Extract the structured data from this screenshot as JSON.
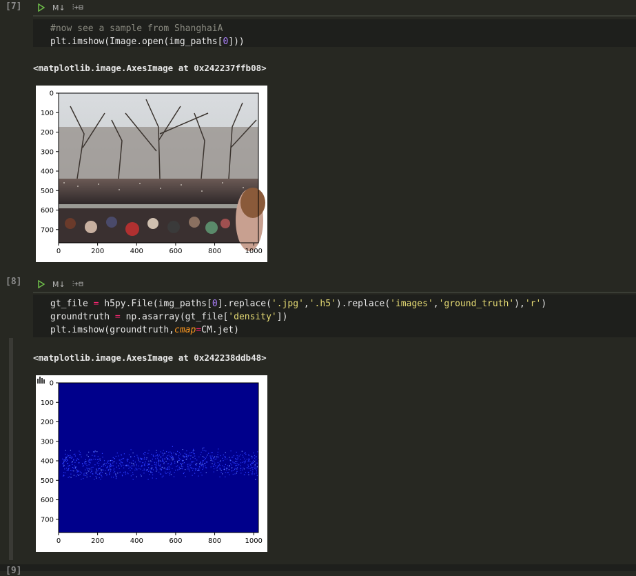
{
  "cells": [
    {
      "exec_count": "[7]",
      "toolbar": {
        "md_label": "M↓",
        "split_label": "⫶+⊟"
      },
      "code_lines": [
        "#now see a sample from ShanghaiA",
        "plt.imshow(Image.open(img_paths[0]))"
      ],
      "output_text": "<matplotlib.image.AxesImage at 0x242237ffb08>",
      "plot": {
        "kind": "photo",
        "x_ticks": [
          "0",
          "200",
          "400",
          "600",
          "800",
          "1000"
        ],
        "y_ticks": [
          "0",
          "100",
          "200",
          "300",
          "400",
          "500",
          "600",
          "700"
        ]
      }
    },
    {
      "exec_count": "[8]",
      "toolbar": {
        "md_label": "M↓",
        "split_label": "⫶+⊟"
      },
      "code_lines": [
        "gt_file = h5py.File(img_paths[0].replace('.jpg','.h5').replace('images','ground_truth'),'r')",
        "groundtruth = np.asarray(gt_file['density'])",
        "plt.imshow(groundtruth,cmap=CM.jet)"
      ],
      "output_text": "<matplotlib.image.AxesImage at 0x242238ddb48>",
      "plot": {
        "kind": "density",
        "x_ticks": [
          "0",
          "200",
          "400",
          "600",
          "800",
          "1000"
        ],
        "y_ticks": [
          "0",
          "100",
          "200",
          "300",
          "400",
          "500",
          "600",
          "700"
        ]
      }
    }
  ],
  "next_cell_count": "[9]",
  "colors": {
    "background": "#272822",
    "code_bg": "#1e1f1c",
    "density_bg": "#00008b",
    "density_points": "#2a3cff"
  }
}
